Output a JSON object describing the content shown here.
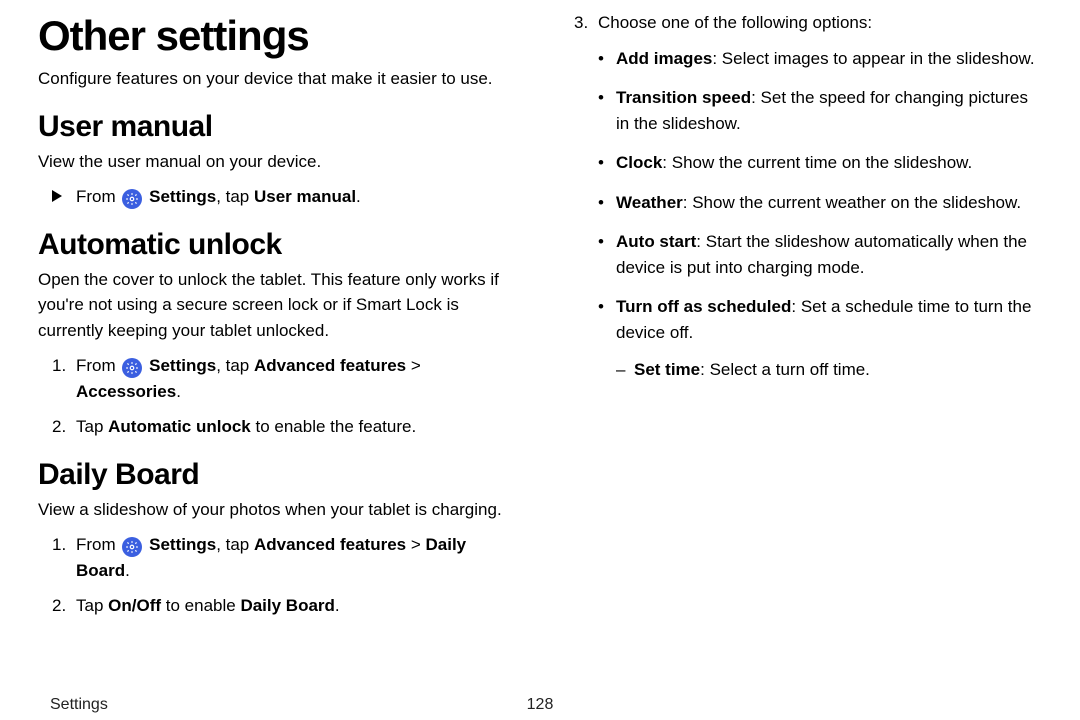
{
  "title": "Other settings",
  "intro": "Configure features on your device that make it easier to use.",
  "user_manual": {
    "heading": "User manual",
    "desc": "View the user manual on your device.",
    "step_pre": "From ",
    "step_label": "Settings",
    "step_mid": ", tap ",
    "step_target": "User manual",
    "step_post": "."
  },
  "auto_unlock": {
    "heading": "Automatic unlock",
    "desc": "Open the cover to unlock the tablet. This feature only works if you're not using a secure screen lock or if Smart Lock is currently keeping your tablet unlocked.",
    "s1_num": "1.",
    "s1_pre": "From ",
    "s1_label": "Settings",
    "s1_mid": ", tap ",
    "s1_t1": "Advanced features",
    "s1_sep": " > ",
    "s1_t2": "Accessories",
    "s1_post": ".",
    "s2_num": "2.",
    "s2_pre": "Tap ",
    "s2_t": "Automatic unlock",
    "s2_post": " to enable the feature."
  },
  "daily_board": {
    "heading": "Daily Board",
    "desc": "View a slideshow of your photos when your tablet is charging.",
    "s1_num": "1.",
    "s1_pre": "From ",
    "s1_label": "Settings",
    "s1_mid": ", tap ",
    "s1_t1": "Advanced features",
    "s1_sep": " > ",
    "s1_t2": "Daily Board",
    "s1_post": ".",
    "s2_num": "2.",
    "s2_pre": "Tap ",
    "s2_t1": "On/Off",
    "s2_mid": " to enable ",
    "s2_t2": "Daily Board",
    "s2_post": ".",
    "s3_num": "3.",
    "s3_text": "Choose one of the following options:",
    "opts": [
      {
        "t": "Add images",
        "d": ": Select images to appear in the slideshow."
      },
      {
        "t": "Transition speed",
        "d": ": Set the speed for changing pictures in the slideshow."
      },
      {
        "t": "Clock",
        "d": ": Show the current time on the slideshow."
      },
      {
        "t": "Weather",
        "d": ": Show the current weather on the slideshow."
      },
      {
        "t": "Auto start",
        "d": ": Start the slideshow automatically when the device is put into charging mode."
      }
    ],
    "opt_sched_t": "Turn off as scheduled",
    "opt_sched_d": ": Set a schedule time to turn the device off.",
    "opt_sched_sub_t": "Set time",
    "opt_sched_sub_d": ": Select a turn off time."
  },
  "footer": {
    "section": "Settings",
    "page": "128"
  }
}
